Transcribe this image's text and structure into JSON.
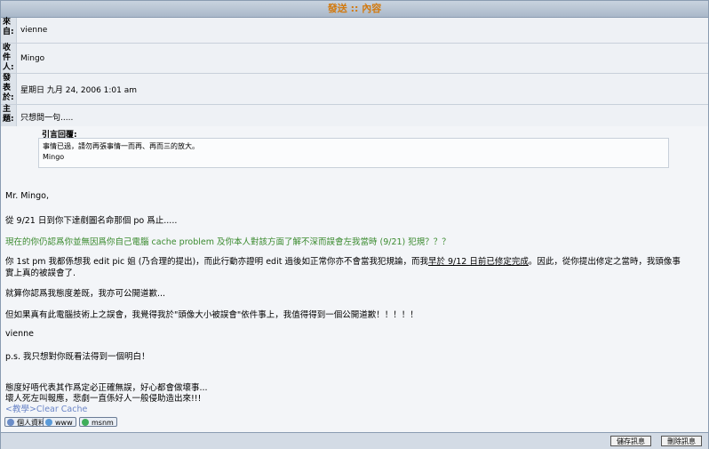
{
  "title": "發送 :: 內容",
  "header": {
    "from_label": "來自:",
    "from_value": "vienne",
    "to_label": "收件人:",
    "to_value": "Mingo",
    "date_label": "發表於:",
    "date_value": "星期日 九月 24, 2006 1:01 am",
    "subject_label": "主題:",
    "subject_value": "只想問一句....."
  },
  "quote": {
    "title": "引言回覆:",
    "line1": "事情已過，請勿再張事情一而再、再而三的放大。",
    "author": "Mingo"
  },
  "message": {
    "line1": "Mr. Mingo,",
    "line2": "從 9/21 日到你下達剷圖名命那個 po 爲止.....",
    "line3": "現在的你仍認爲你並無因爲你自己電腦 cache problem 及你本人對該方面了解不深而誤會左我當時 (9/21) 犯規？？？",
    "line4a": "你 1st pm 我都係想我 edit pic 姐 (乃合理的提出)，而此行動亦證明 edit 過後如正常你亦不會當我犯規論，而我",
    "line4b": "早於 9/12 日前已修定完成",
    "line4c": "。因此，從你提出修定之當時，我頭像事",
    "line5": "實上真的被誤會了.",
    "line6": "就算你認爲我態度差既，我亦可公開道歉...",
    "line7": "但如果真有此電腦技術上之誤會，我覺得我於\"頭像大小被誤會\"依件事上，我值得得到一個公開道歉！！！！！",
    "line8": "vienne",
    "line9": "p.s. 我只想對你既看法得到一個明白！",
    "sig1": "態度好唔代表其作爲定必正確無誤，好心都會做壞事...",
    "sig2": "壞人死左叫報應，悲劇一直係好人一般侵助造出來!!!",
    "sig_link": "<教學>Clear Cache"
  },
  "profile_buttons": {
    "profile": "個人資料",
    "www": "www",
    "msnm": "msnm"
  },
  "footer": {
    "save": "儲存訊息",
    "delete": "刪除訊息"
  }
}
